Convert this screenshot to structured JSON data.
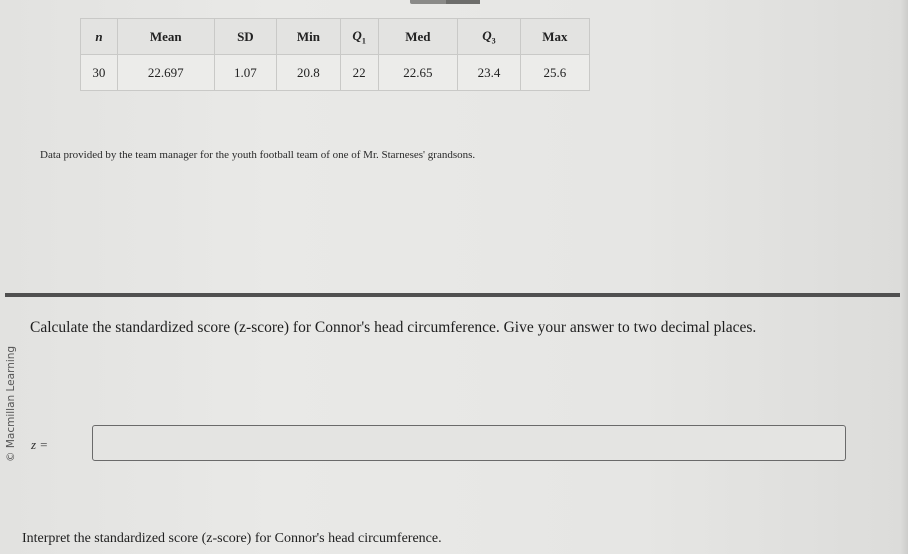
{
  "summary_table": {
    "headers": [
      {
        "main": "n",
        "italic": true,
        "sub": ""
      },
      {
        "main": "Mean",
        "italic": false,
        "sub": ""
      },
      {
        "main": "SD",
        "italic": false,
        "sub": ""
      },
      {
        "main": "Min",
        "italic": false,
        "sub": ""
      },
      {
        "main": "Q",
        "italic": true,
        "sub": "1"
      },
      {
        "main": "Med",
        "italic": false,
        "sub": ""
      },
      {
        "main": "Q",
        "italic": true,
        "sub": "3"
      },
      {
        "main": "Max",
        "italic": false,
        "sub": ""
      }
    ],
    "row": [
      "30",
      "22.697",
      "1.07",
      "20.8",
      "22",
      "22.65",
      "23.4",
      "25.6"
    ]
  },
  "source_note": "Data provided by the team manager for the youth football team of one of Mr. Starneses' grandsons.",
  "copyright": "© Macmillan Learning",
  "question_1": "Calculate the standardized score (z-score) for Connor's head circumference. Give your answer to two decimal places.",
  "answer": {
    "label_var": "z",
    "label_eq": "=",
    "value": "",
    "placeholder": ""
  },
  "question_2": "Interpret the standardized score (z-score) for Connor's head circumference."
}
